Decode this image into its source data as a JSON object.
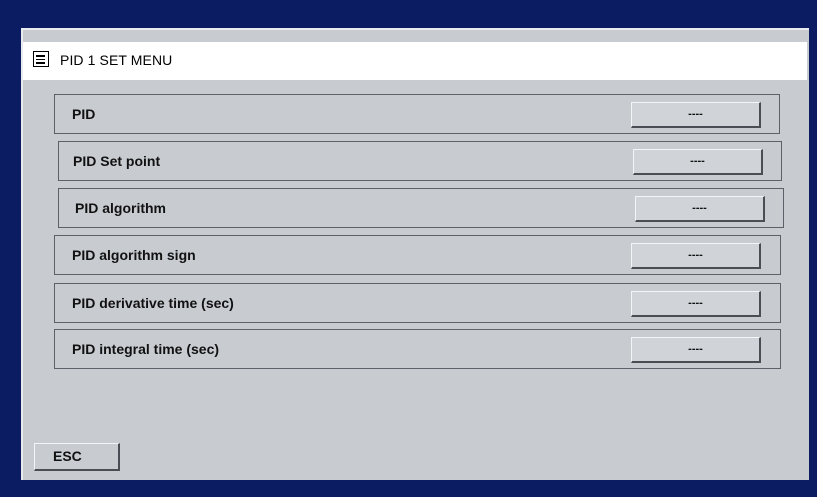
{
  "header": {
    "title": "PID 1 SET MENU",
    "icon": "menu-list-icon"
  },
  "rows": [
    {
      "label": "PID",
      "value": "----"
    },
    {
      "label": "PID Set point",
      "value": "----"
    },
    {
      "label": "PID algorithm",
      "value": "----"
    },
    {
      "label": "PID algorithm sign",
      "value": "----"
    },
    {
      "label": "PID derivative time (sec)",
      "value": "----"
    },
    {
      "label": "PID integral time (sec)",
      "value": "----"
    }
  ],
  "footer": {
    "esc_label": "ESC"
  },
  "colors": {
    "frame": "#0b1c63",
    "panel": "#c8ccd1",
    "header": "#ffffff"
  }
}
